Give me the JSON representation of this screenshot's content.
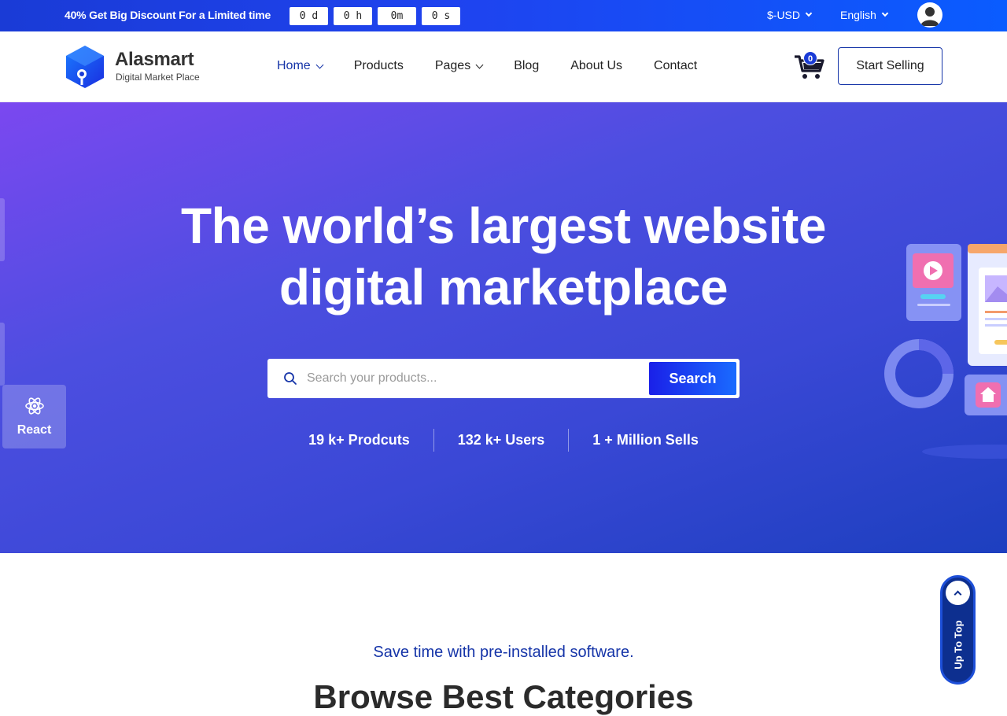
{
  "topbar": {
    "promo_pct": "40%",
    "promo_text": "Get Big Discount For a Limited time",
    "countdown": [
      "0 d",
      "0 h",
      "0m",
      "0 s"
    ],
    "currency": "$-USD",
    "language": "English"
  },
  "header": {
    "brand_name": "Alasmart",
    "brand_tagline": "Digital Market Place",
    "nav": [
      {
        "label": "Home",
        "dropdown": true,
        "active": true
      },
      {
        "label": "Products",
        "dropdown": false
      },
      {
        "label": "Pages",
        "dropdown": true
      },
      {
        "label": "Blog",
        "dropdown": false
      },
      {
        "label": "About Us",
        "dropdown": false
      },
      {
        "label": "Contact",
        "dropdown": false
      }
    ],
    "cart_count": "0",
    "sell_button": "Start Selling"
  },
  "hero": {
    "title_line1": "The world’s largest website",
    "title_line2": "digital marketplace",
    "search_placeholder": "Search your products...",
    "search_button": "Search",
    "stats": [
      "19 k+ Prodcuts",
      "132 k+ Users",
      "1 + Million Sells"
    ],
    "badge_label": "React"
  },
  "section": {
    "tagline": "Save time with pre-installed software.",
    "title": "Browse Best Categories"
  },
  "up_to_top": "Up To Top",
  "colors": {
    "accent": "#1534a8",
    "hero_start": "#7b48f0",
    "hero_end": "#1d3fbf"
  }
}
